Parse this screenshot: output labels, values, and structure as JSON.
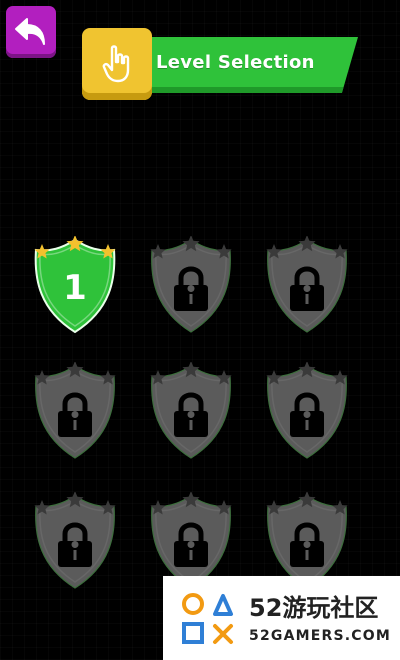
{
  "header": {
    "title": "Level Selection",
    "back_icon": "undo-arrow-icon",
    "hand_icon": "pointer-hand-icon"
  },
  "levels": [
    {
      "label": "1",
      "state": "unlocked",
      "stars": 3
    },
    {
      "label": "",
      "state": "locked",
      "stars": 0
    },
    {
      "label": "",
      "state": "locked",
      "stars": 0
    },
    {
      "label": "",
      "state": "locked",
      "stars": 0
    },
    {
      "label": "",
      "state": "locked",
      "stars": 0
    },
    {
      "label": "",
      "state": "locked",
      "stars": 0
    },
    {
      "label": "",
      "state": "locked",
      "stars": 0
    },
    {
      "label": "",
      "state": "locked",
      "stars": 0
    },
    {
      "label": "",
      "state": "locked",
      "stars": 0
    }
  ],
  "colors": {
    "unlocked_shield": "#2fc23a",
    "locked_shield": "#5b5b5b",
    "star_filled": "#f2c12e",
    "star_empty": "#3a3a3a",
    "back_button": "#b21fbf",
    "banner": "#2fc23a",
    "hand_button": "#f0c430"
  },
  "watermark": {
    "cn_text": "52游玩社区",
    "en_text": "52GAMERS.COM"
  }
}
